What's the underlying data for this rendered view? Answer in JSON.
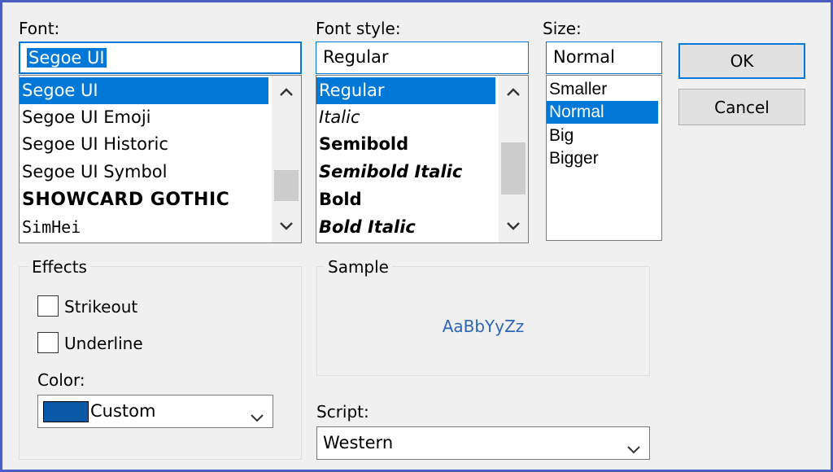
{
  "font": {
    "label": "Font:",
    "current_value": "Segoe UI",
    "items": [
      "Segoe UI",
      "Segoe UI Emoji",
      "Segoe UI Historic",
      "Segoe UI Symbol",
      "SHOWCARD GOTHIC",
      "SimHei"
    ],
    "selected_index": 0
  },
  "font_style": {
    "label": "Font style:",
    "current_value": "Regular",
    "items": [
      "Regular",
      "Italic",
      "Semibold",
      "Semibold Italic",
      "Bold",
      "Bold Italic"
    ],
    "selected_index": 0
  },
  "size": {
    "label": "Size:",
    "current_value": "Normal",
    "items": [
      "Smaller",
      "Normal",
      "Big",
      "Bigger"
    ],
    "selected_index": 1
  },
  "buttons": {
    "ok_label": "OK",
    "cancel_label": "Cancel"
  },
  "effects": {
    "title": "Effects",
    "strikeout_label": "Strikeout",
    "strikeout_checked": false,
    "underline_label": "Underline",
    "underline_checked": false,
    "color_label": "Color:",
    "color_value": "Custom",
    "color_swatch": "#0b5aa8"
  },
  "sample": {
    "title": "Sample",
    "text": "AaBbYyZz",
    "text_color": "#2b66b8"
  },
  "script": {
    "label": "Script:",
    "value": "Western"
  },
  "icons": {
    "scroll_up": "chevron-up-icon",
    "scroll_down": "chevron-down-icon",
    "dropdown": "chevron-down-icon"
  },
  "colors": {
    "selection": "#0078d7",
    "dialog_bg": "#f0f0f0",
    "frame_border": "#4a5fc1"
  }
}
